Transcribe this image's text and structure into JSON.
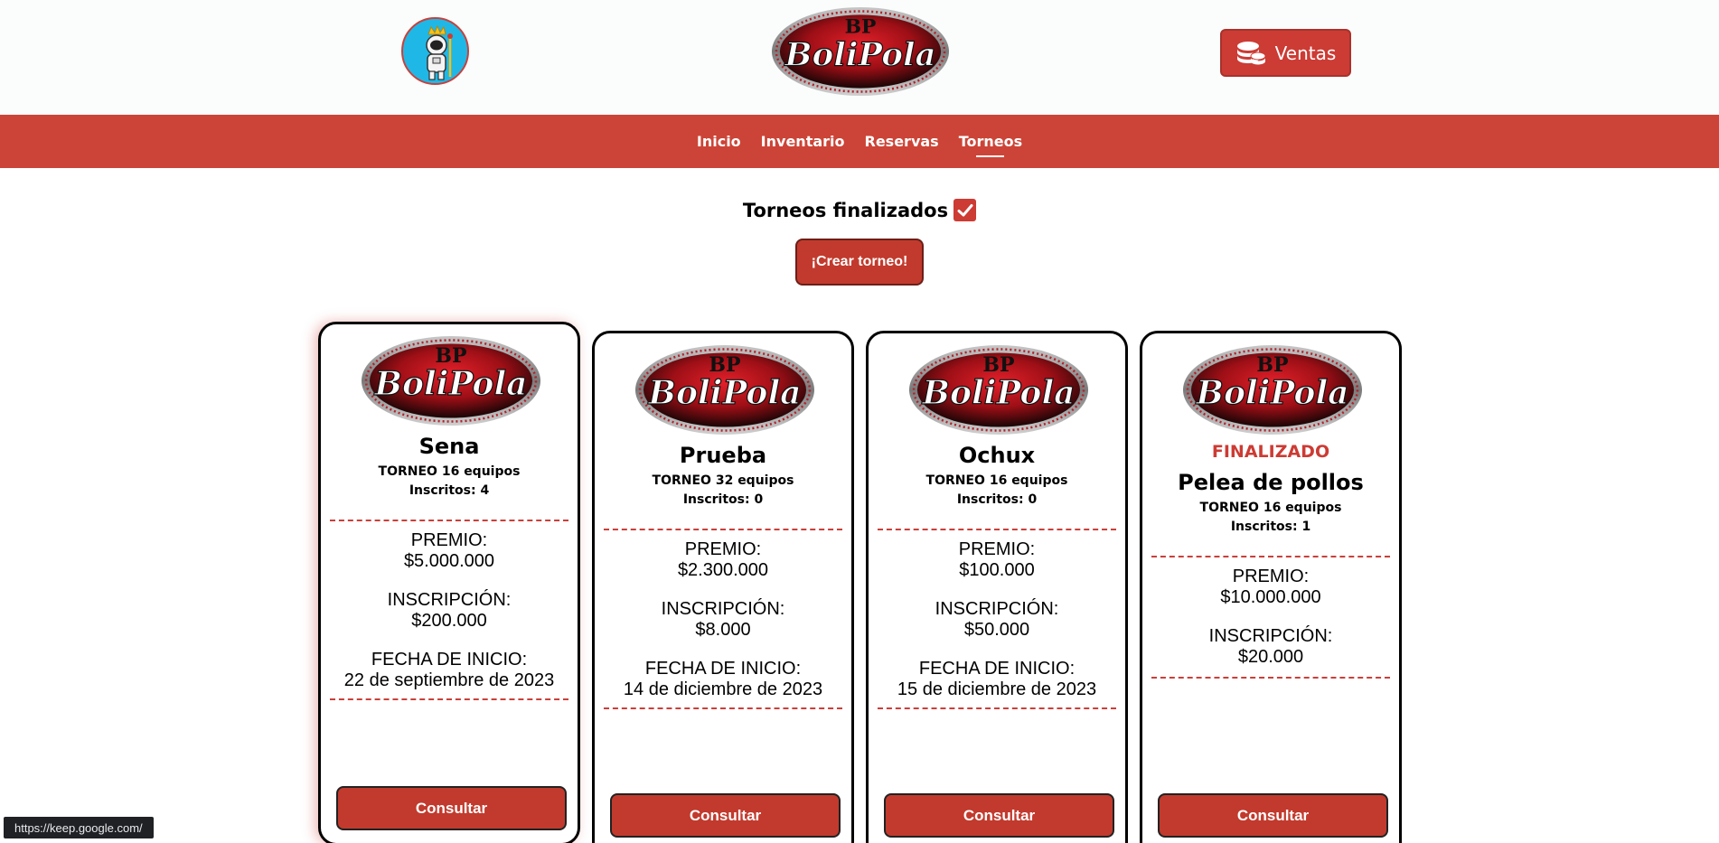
{
  "header": {
    "avatar_icon": "astronaut-king-icon",
    "logo_text": "BoliPola",
    "logo_monogram": "BP",
    "ventas_label": "Ventas",
    "ventas_icon": "coins-stack-icon"
  },
  "nav": {
    "items": [
      {
        "label": "Inicio",
        "active": false
      },
      {
        "label": "Inventario",
        "active": false
      },
      {
        "label": "Reservas",
        "active": false
      },
      {
        "label": "Torneos",
        "active": true
      }
    ]
  },
  "filter": {
    "label": "Torneos finalizados",
    "checked": true
  },
  "create_button": "¡Crear torneo!",
  "tournaments": [
    {
      "status": "",
      "name": "Sena",
      "type_line": "TORNEO 16 equipos",
      "enrolled": "Inscritos: 4",
      "premio_label": "PREMIO:",
      "premio": "$5.000.000",
      "inscripcion_label": "INSCRIPCIÓN:",
      "inscripcion": "$200.000",
      "fecha_label": "FECHA DE INICIO:",
      "fecha": "22 de septiembre de 2023",
      "button": "Consultar"
    },
    {
      "status": "",
      "name": "Prueba",
      "type_line": "TORNEO 32 equipos",
      "enrolled": "Inscritos: 0",
      "premio_label": "PREMIO:",
      "premio": "$2.300.000",
      "inscripcion_label": "INSCRIPCIÓN:",
      "inscripcion": "$8.000",
      "fecha_label": "FECHA DE INICIO:",
      "fecha": "14 de diciembre de 2023",
      "button": "Consultar"
    },
    {
      "status": "",
      "name": "Ochux",
      "type_line": "TORNEO 16 equipos",
      "enrolled": "Inscritos: 0",
      "premio_label": "PREMIO:",
      "premio": "$100.000",
      "inscripcion_label": "INSCRIPCIÓN:",
      "inscripcion": "$50.000",
      "fecha_label": "FECHA DE INICIO:",
      "fecha": "15 de diciembre de 2023",
      "button": "Consultar"
    },
    {
      "status": "FINALIZADO",
      "name": "Pelea de pollos",
      "type_line": "TORNEO 16 equipos",
      "enrolled": "Inscritos: 1",
      "premio_label": "PREMIO:",
      "premio": "$10.000.000",
      "inscripcion_label": "INSCRIPCIÓN:",
      "inscripcion": "$20.000",
      "button": "Consultar"
    }
  ],
  "status_bar": {
    "url": "https://keep.google.com/"
  },
  "colors": {
    "brand_red": "#cc4437",
    "button_red": "#c23a2d",
    "divider_red": "#c9403a"
  }
}
